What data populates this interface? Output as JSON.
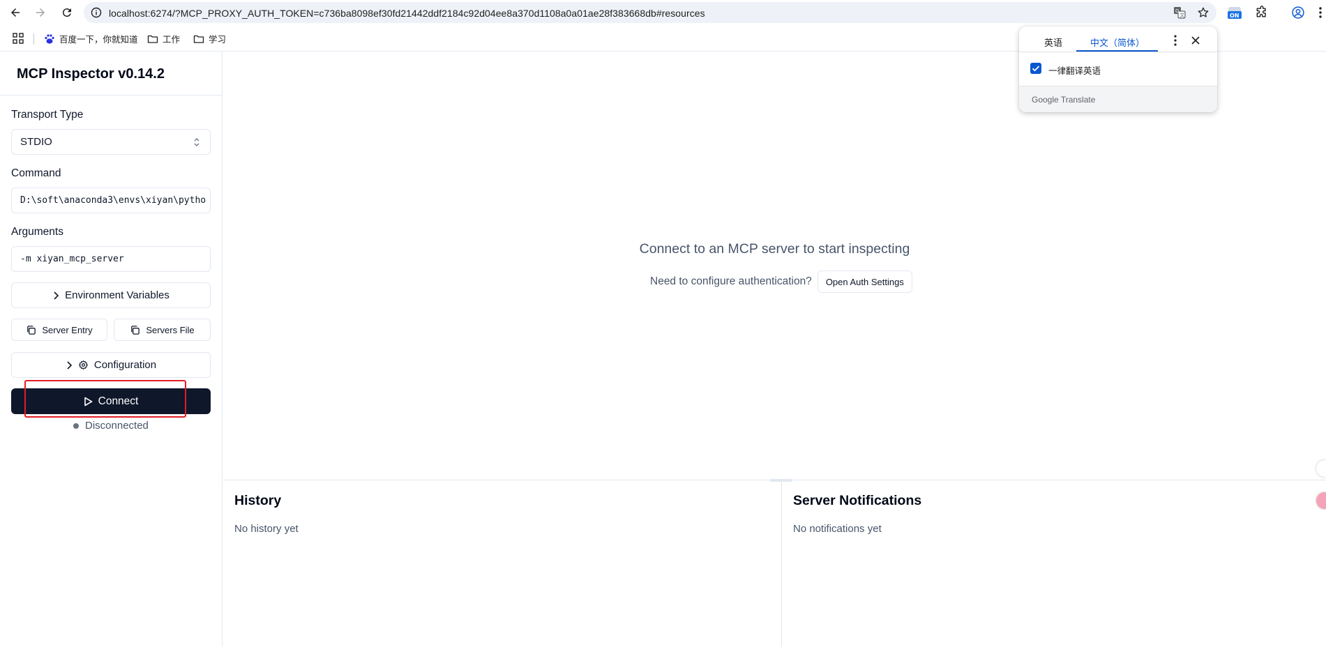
{
  "browser": {
    "url": "localhost:6274/?MCP_PROXY_AUTH_TOKEN=c736ba8098ef30fd21442ddf2184c92d04ee8a370d1108a0a01ae28f383668db#resources",
    "extension_badge": "ON",
    "bookmarks": [
      {
        "label": "百度一下，你就知道",
        "icon": "baidu-icon"
      },
      {
        "label": "工作",
        "icon": "folder-icon"
      },
      {
        "label": "学习",
        "icon": "folder-icon"
      }
    ]
  },
  "translate_popup": {
    "tab_source": "英语",
    "tab_target": "中文（简体）",
    "checkbox_label": "一律翻译英语",
    "checked": true,
    "footer": "Google Translate"
  },
  "sidebar": {
    "title": "MCP Inspector v0.14.2",
    "transport_label": "Transport Type",
    "transport_value": "STDIO",
    "command_label": "Command",
    "command_value": "D:\\soft\\anaconda3\\envs\\xiyan\\pytho",
    "arguments_label": "Arguments",
    "arguments_value": "-m xiyan_mcp_server",
    "env_button": "Environment Variables",
    "server_entry_button": "Server Entry",
    "servers_file_button": "Servers File",
    "config_button": "Configuration",
    "connect_button": "Connect",
    "status": "Disconnected"
  },
  "main": {
    "empty_title": "Connect to an MCP server to start inspecting",
    "auth_prompt": "Need to configure authentication?",
    "auth_button": "Open Auth Settings"
  },
  "history": {
    "title": "History",
    "empty": "No history yet"
  },
  "notifications": {
    "title": "Server Notifications",
    "empty": "No notifications yet"
  },
  "colors": {
    "primary": "#0f172a",
    "border": "#e2e8f0",
    "muted_text": "#475569",
    "highlight": "#e11d28",
    "google_blue": "#0b57d0"
  }
}
